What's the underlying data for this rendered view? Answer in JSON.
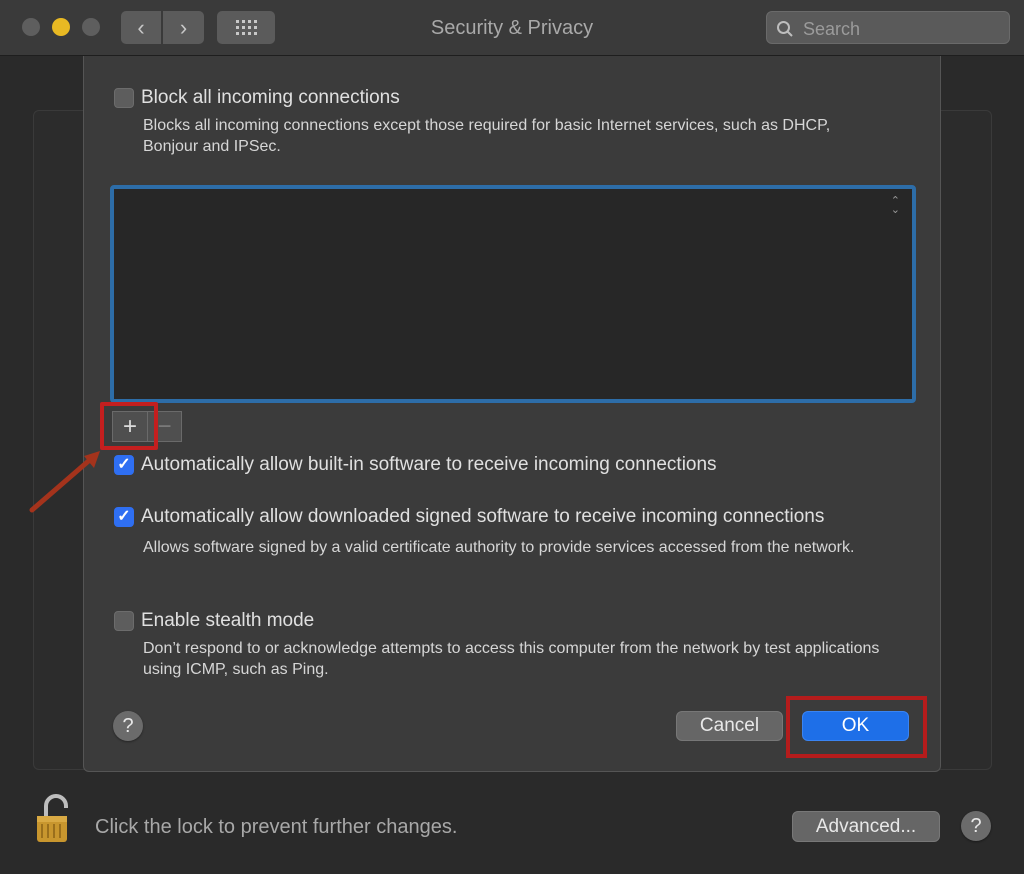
{
  "window": {
    "title": "Security & Privacy",
    "search_placeholder": "Search"
  },
  "toolbar": {
    "back_glyph": "‹",
    "forward_glyph": "›"
  },
  "firewall": {
    "block_all": {
      "label": "Block all incoming connections",
      "checked": false,
      "description": "Blocks all incoming connections except those required for basic Internet services, such as DHCP, Bonjour and IPSec."
    },
    "applist": {
      "items": [],
      "add_label": "+",
      "remove_label": "−"
    },
    "auto_builtin": {
      "label": "Automatically allow built-in software to receive incoming connections",
      "checked": true
    },
    "auto_signed": {
      "label": "Automatically allow downloaded signed software to receive incoming connections",
      "checked": true,
      "description": "Allows software signed by a valid certificate authority to provide services accessed from the network."
    },
    "stealth": {
      "label": "Enable stealth mode",
      "checked": false,
      "description": "Don’t respond to or acknowledge attempts to access this computer from the network by test applications using ICMP, such as Ping."
    },
    "help_label": "?",
    "cancel_label": "Cancel",
    "ok_label": "OK"
  },
  "footer": {
    "lock_text": "Click the lock to prevent further changes.",
    "advanced_label": "Advanced...",
    "help_label": "?"
  },
  "colors": {
    "accent": "#2f6ff2",
    "highlight_red": "#c41f1f",
    "list_focus_ring": "#2d6da8"
  },
  "icons": [
    "search-icon",
    "lock-icon",
    "checkmark-icon",
    "chevron-left-icon",
    "chevron-right-icon",
    "grid-icon",
    "sort-arrows-icon",
    "help-icon"
  ]
}
